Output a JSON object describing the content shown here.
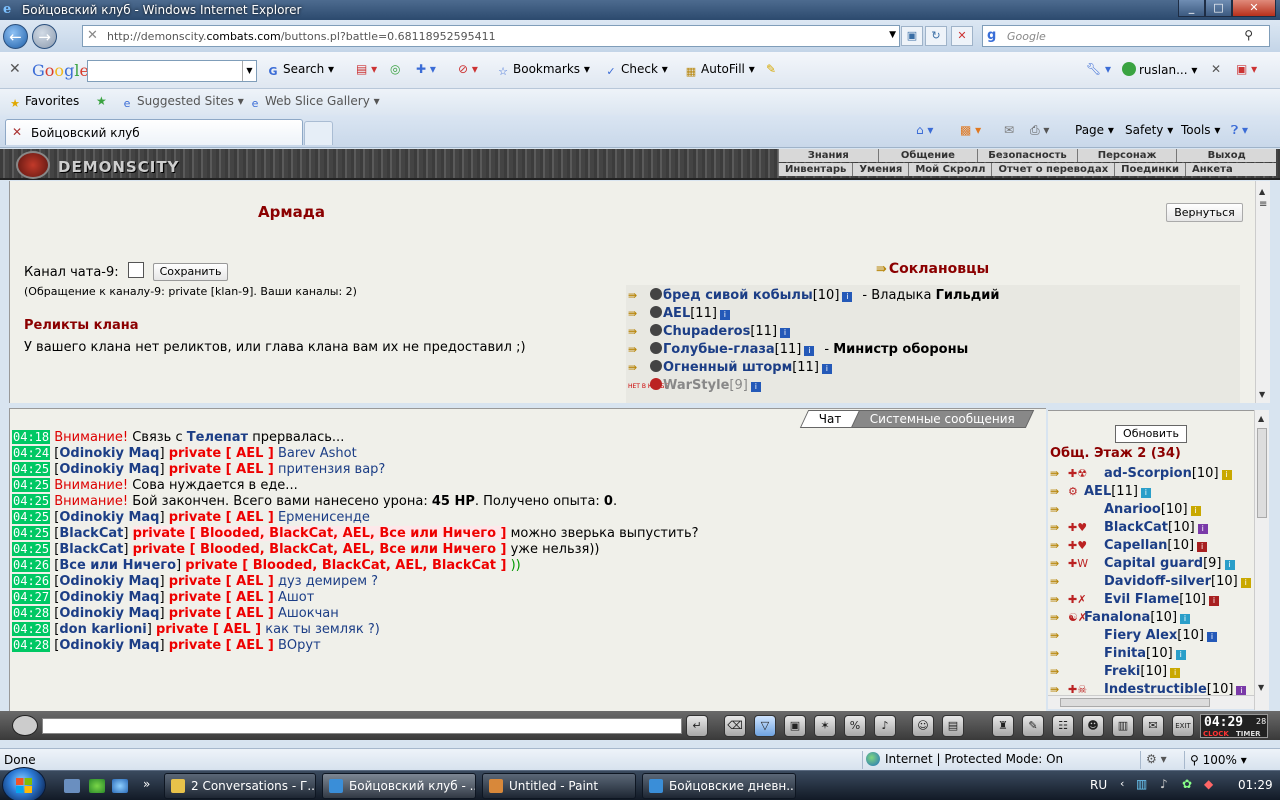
{
  "window": {
    "title": "Бойцовский клуб - Windows Internet Explorer",
    "min": "_",
    "max": "□",
    "close": "✕"
  },
  "address": {
    "url_prefix": "http://demonscity.",
    "url_domain": "combats.com",
    "url_rest": "/buttons.pl?battle=0.68118952595411",
    "search_placeholder": "Google"
  },
  "google_toolbar": {
    "logo": [
      "G",
      "o",
      "o",
      "g",
      "l",
      "e"
    ],
    "search_label": "Search",
    "bookmarks_label": "Bookmarks",
    "check_label": "Check",
    "autofill_label": "AutoFill",
    "user_label": "ruslan..."
  },
  "favorites_bar": {
    "favorites_label": "Favorites",
    "suggested_label": "Suggested Sites",
    "webslice_label": "Web Slice Gallery"
  },
  "tabs": {
    "active_label": "Бойцовский клуб",
    "page_label": "Page",
    "safety_label": "Safety",
    "tools_label": "Tools"
  },
  "game_header": {
    "logo_text": "DEMONSCITY",
    "menu_top": [
      "Знания",
      "Общение",
      "Безопасность",
      "Персонаж",
      "Выход"
    ],
    "menu_bottom": [
      "Инвентарь",
      "Умения",
      "Мой Скролл",
      "Отчет о переводах",
      "Поединки",
      "Анкета"
    ]
  },
  "clan_page": {
    "title": "Армада",
    "return_label": "Вернуться",
    "channel_label": "Канал чата-9:",
    "save_label": "Сохранить",
    "channel_note": "(Обращение к каналу-9: private [klan-9]. Ваши каналы: 2)",
    "relics_heading": "Реликты клана",
    "relics_text": "У вашего клана нет реликтов, или глава клана вам их не предоставил ;)",
    "allies_heading": "Соклановцы",
    "allies": [
      {
        "name": "бред сивой кобылы",
        "level": "[10]",
        "role": "- Владыка ",
        "role_bold": "Гильдий",
        "online": true
      },
      {
        "name": "AEL",
        "level": "[11]",
        "role": "",
        "role_bold": "",
        "online": true
      },
      {
        "name": "Chupaderos",
        "level": "[11]",
        "role": "",
        "role_bold": "",
        "online": true
      },
      {
        "name": "Голубые-глаза",
        "level": "[11]",
        "role": "- ",
        "role_bold": "Министр обороны",
        "online": true
      },
      {
        "name": "Огненный шторм",
        "level": "[11]",
        "role": "",
        "role_bold": "",
        "online": true
      },
      {
        "name": "WarStyle",
        "level": "[9]",
        "role": "",
        "role_bold": "",
        "online": false
      }
    ],
    "noclan_label": "НЕТ В КЛУБЕ"
  },
  "chat": {
    "tab_chat": "Чат",
    "tab_system": "Системные сообщения",
    "lines": [
      {
        "ts": "04:18",
        "warn": "Внимание!",
        "plain1": " Связь с ",
        "nick": "",
        "bold": "Телепат",
        "plain2": " прервалась..."
      },
      {
        "ts": "04:24",
        "nick": "Odinokiy Maq",
        "priv": "private [ AEL ]",
        "msg": "Barev Ashot"
      },
      {
        "ts": "04:25",
        "nick": "Odinokiy Maq",
        "priv": "private [ AEL ]",
        "msg": "притензия вар?"
      },
      {
        "ts": "04:25",
        "warn": "Внимание!",
        "plain1": " Сова нуждается в еде...",
        "nick": "",
        "bold": "",
        "plain2": ""
      },
      {
        "ts": "04:25",
        "warn": "Внимание!",
        "plain1": " Бой закончен. Всего вами нанесено урона: ",
        "bold": "45 HP",
        "plain2": ". Получено опыта: ",
        "bold2": "0",
        "plain3": "."
      },
      {
        "ts": "04:25",
        "nick": "Odinokiy Maq",
        "priv": "private [ AEL ]",
        "msg": "Ерменисенде"
      },
      {
        "ts": "04:25",
        "nick": "BlackCat",
        "priv": "private [ Blooded, BlackCat, AEL, Все или Ничего ]",
        "msg": " можно зверька выпустить?",
        "privbg": true,
        "msgplain": true
      },
      {
        "ts": "04:25",
        "nick": "BlackCat",
        "priv": "private [ Blooded, BlackCat, AEL, Все или Ничего ]",
        "msg": " уже нельзя))",
        "msgplain": true
      },
      {
        "ts": "04:26",
        "nick": "Все или Ничего",
        "priv": "private [ Blooded, BlackCat, AEL, BlackCat ]",
        "msg": " ))",
        "msggreen": true
      },
      {
        "ts": "04:26",
        "nick": "Odinokiy Maq",
        "priv": "private [ AEL ]",
        "msg": "дуз демирем ?"
      },
      {
        "ts": "04:27",
        "nick": "Odinokiy Maq",
        "priv": "private [ AEL ]",
        "msg": "Ашот"
      },
      {
        "ts": "04:28",
        "nick": "Odinokiy Maq",
        "priv": "private [ AEL ]",
        "msg": "Ашокчан"
      },
      {
        "ts": "04:28",
        "nick": "don karlioni",
        "priv": "private [ AEL ]",
        "msg": "как ты земляк ?)"
      },
      {
        "ts": "04:28",
        "nick": "Odinokiy Maq",
        "priv": "private [ AEL ]",
        "msg": "ВОрут"
      }
    ]
  },
  "online": {
    "refresh_label": "Обновить",
    "heading": "Общ. Этаж 2 (34)",
    "users": [
      {
        "name": "ad-Scorpion",
        "level": "[10]",
        "info_color": "#c9a800",
        "icons": "✚☢"
      },
      {
        "name": "AEL",
        "level": "[11]",
        "info_color": "#2a9ec9",
        "icons": "⚙"
      },
      {
        "name": "Anarioo",
        "level": "[10]",
        "info_color": "#c9a800",
        "icons": ""
      },
      {
        "name": "BlackCat",
        "level": "[10]",
        "info_color": "#7a3aa8",
        "icons": "✚♥"
      },
      {
        "name": "Capellan",
        "level": "[10]",
        "info_color": "#a82020",
        "icons": "✚♥"
      },
      {
        "name": "Capital guard",
        "level": "[9]",
        "info_color": "#2a9ec9",
        "icons": "✚W"
      },
      {
        "name": "Davidoff-silver",
        "level": "[10]",
        "info_color": "#c9a800",
        "icons": ""
      },
      {
        "name": "Evil Flame",
        "level": "[10]",
        "info_color": "#a82020",
        "icons": "✚✗"
      },
      {
        "name": "Fanalona",
        "level": "[10]",
        "info_color": "#2a9ec9",
        "icons": "☯✗"
      },
      {
        "name": "Fiery Alex",
        "level": "[10]",
        "info_color": "#2459b8",
        "icons": ""
      },
      {
        "name": "Finita",
        "level": "[10]",
        "info_color": "#2a9ec9",
        "icons": ""
      },
      {
        "name": "Freki",
        "level": "[10]",
        "info_color": "#c9a800",
        "icons": ""
      },
      {
        "name": "Indestructible",
        "level": "[10]",
        "info_color": "#7a3aa8",
        "icons": "✚☠"
      }
    ]
  },
  "clock": {
    "time": "04:29",
    "sec": "28",
    "label1": "CLOCK",
    "label2": "TIMER"
  },
  "status": {
    "text": "Done",
    "zone": "Internet | Protected Mode: On",
    "zoom": "100%"
  },
  "taskbar": {
    "items": [
      {
        "label": "2 Conversations - Г...",
        "color": "#e8c24a"
      },
      {
        "label": "Бойцовский клуб - ...",
        "color": "#3a8ed8",
        "active": true
      },
      {
        "label": "Untitled - Paint",
        "color": "#d8883a"
      },
      {
        "label": "Бойцовские дневн...",
        "color": "#3a8ed8"
      }
    ],
    "lang": "RU",
    "time": "01:29"
  }
}
